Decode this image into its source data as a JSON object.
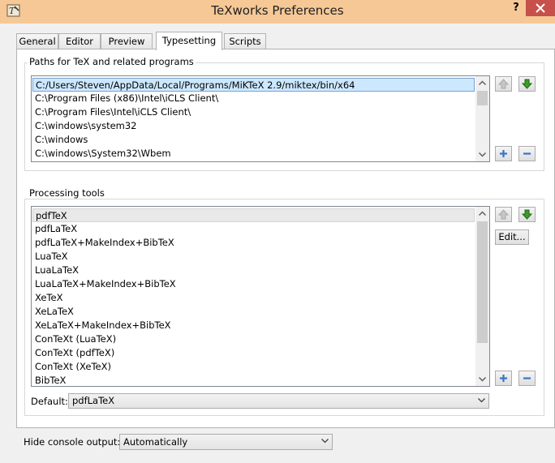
{
  "window": {
    "title": "TeXworks Preferences",
    "help_label": "?"
  },
  "tabs": [
    {
      "label": "General",
      "active": false
    },
    {
      "label": "Editor",
      "active": false
    },
    {
      "label": "Preview",
      "active": false
    },
    {
      "label": "Typesetting",
      "active": true
    },
    {
      "label": "Scripts",
      "active": false
    }
  ],
  "paths_group": {
    "title": "Paths for TeX and related programs",
    "selected_index": 0,
    "items": [
      "C:/Users/Steven/AppData/Local/Programs/MiKTeX 2.9/miktex/bin/x64",
      "C:\\Program Files (x86)\\Intel\\iCLS Client\\",
      "C:\\Program Files\\Intel\\iCLS Client\\",
      "C:\\windows\\system32",
      "C:\\windows",
      "C:\\windows\\System32\\Wbem"
    ]
  },
  "tools_group": {
    "title": "Processing tools",
    "selected_index": 0,
    "items": [
      "pdfTeX",
      "pdfLaTeX",
      "pdfLaTeX+MakeIndex+BibTeX",
      "LuaTeX",
      "LuaLaTeX",
      "LuaLaTeX+MakeIndex+BibTeX",
      "XeTeX",
      "XeLaTeX",
      "XeLaTeX+MakeIndex+BibTeX",
      "ConTeXt (LuaTeX)",
      "ConTeXt (pdfTeX)",
      "ConTeXt (XeTeX)",
      "BibTeX"
    ],
    "edit_label": "Edit...",
    "default_label": "Default:",
    "default_value": "pdfLaTeX"
  },
  "console": {
    "label": "Hide console output:",
    "value": "Automatically"
  },
  "icons": {
    "move_up": "up-arrow-icon",
    "move_down": "down-arrow-icon",
    "add": "plus-icon",
    "remove": "minus-icon"
  },
  "colors": {
    "titlebar": "#f5c896",
    "close": "#c7504a",
    "arrow_green": "#3d9a2a",
    "plus_blue": "#3a74c4",
    "selection_border": "#7da2ce"
  }
}
